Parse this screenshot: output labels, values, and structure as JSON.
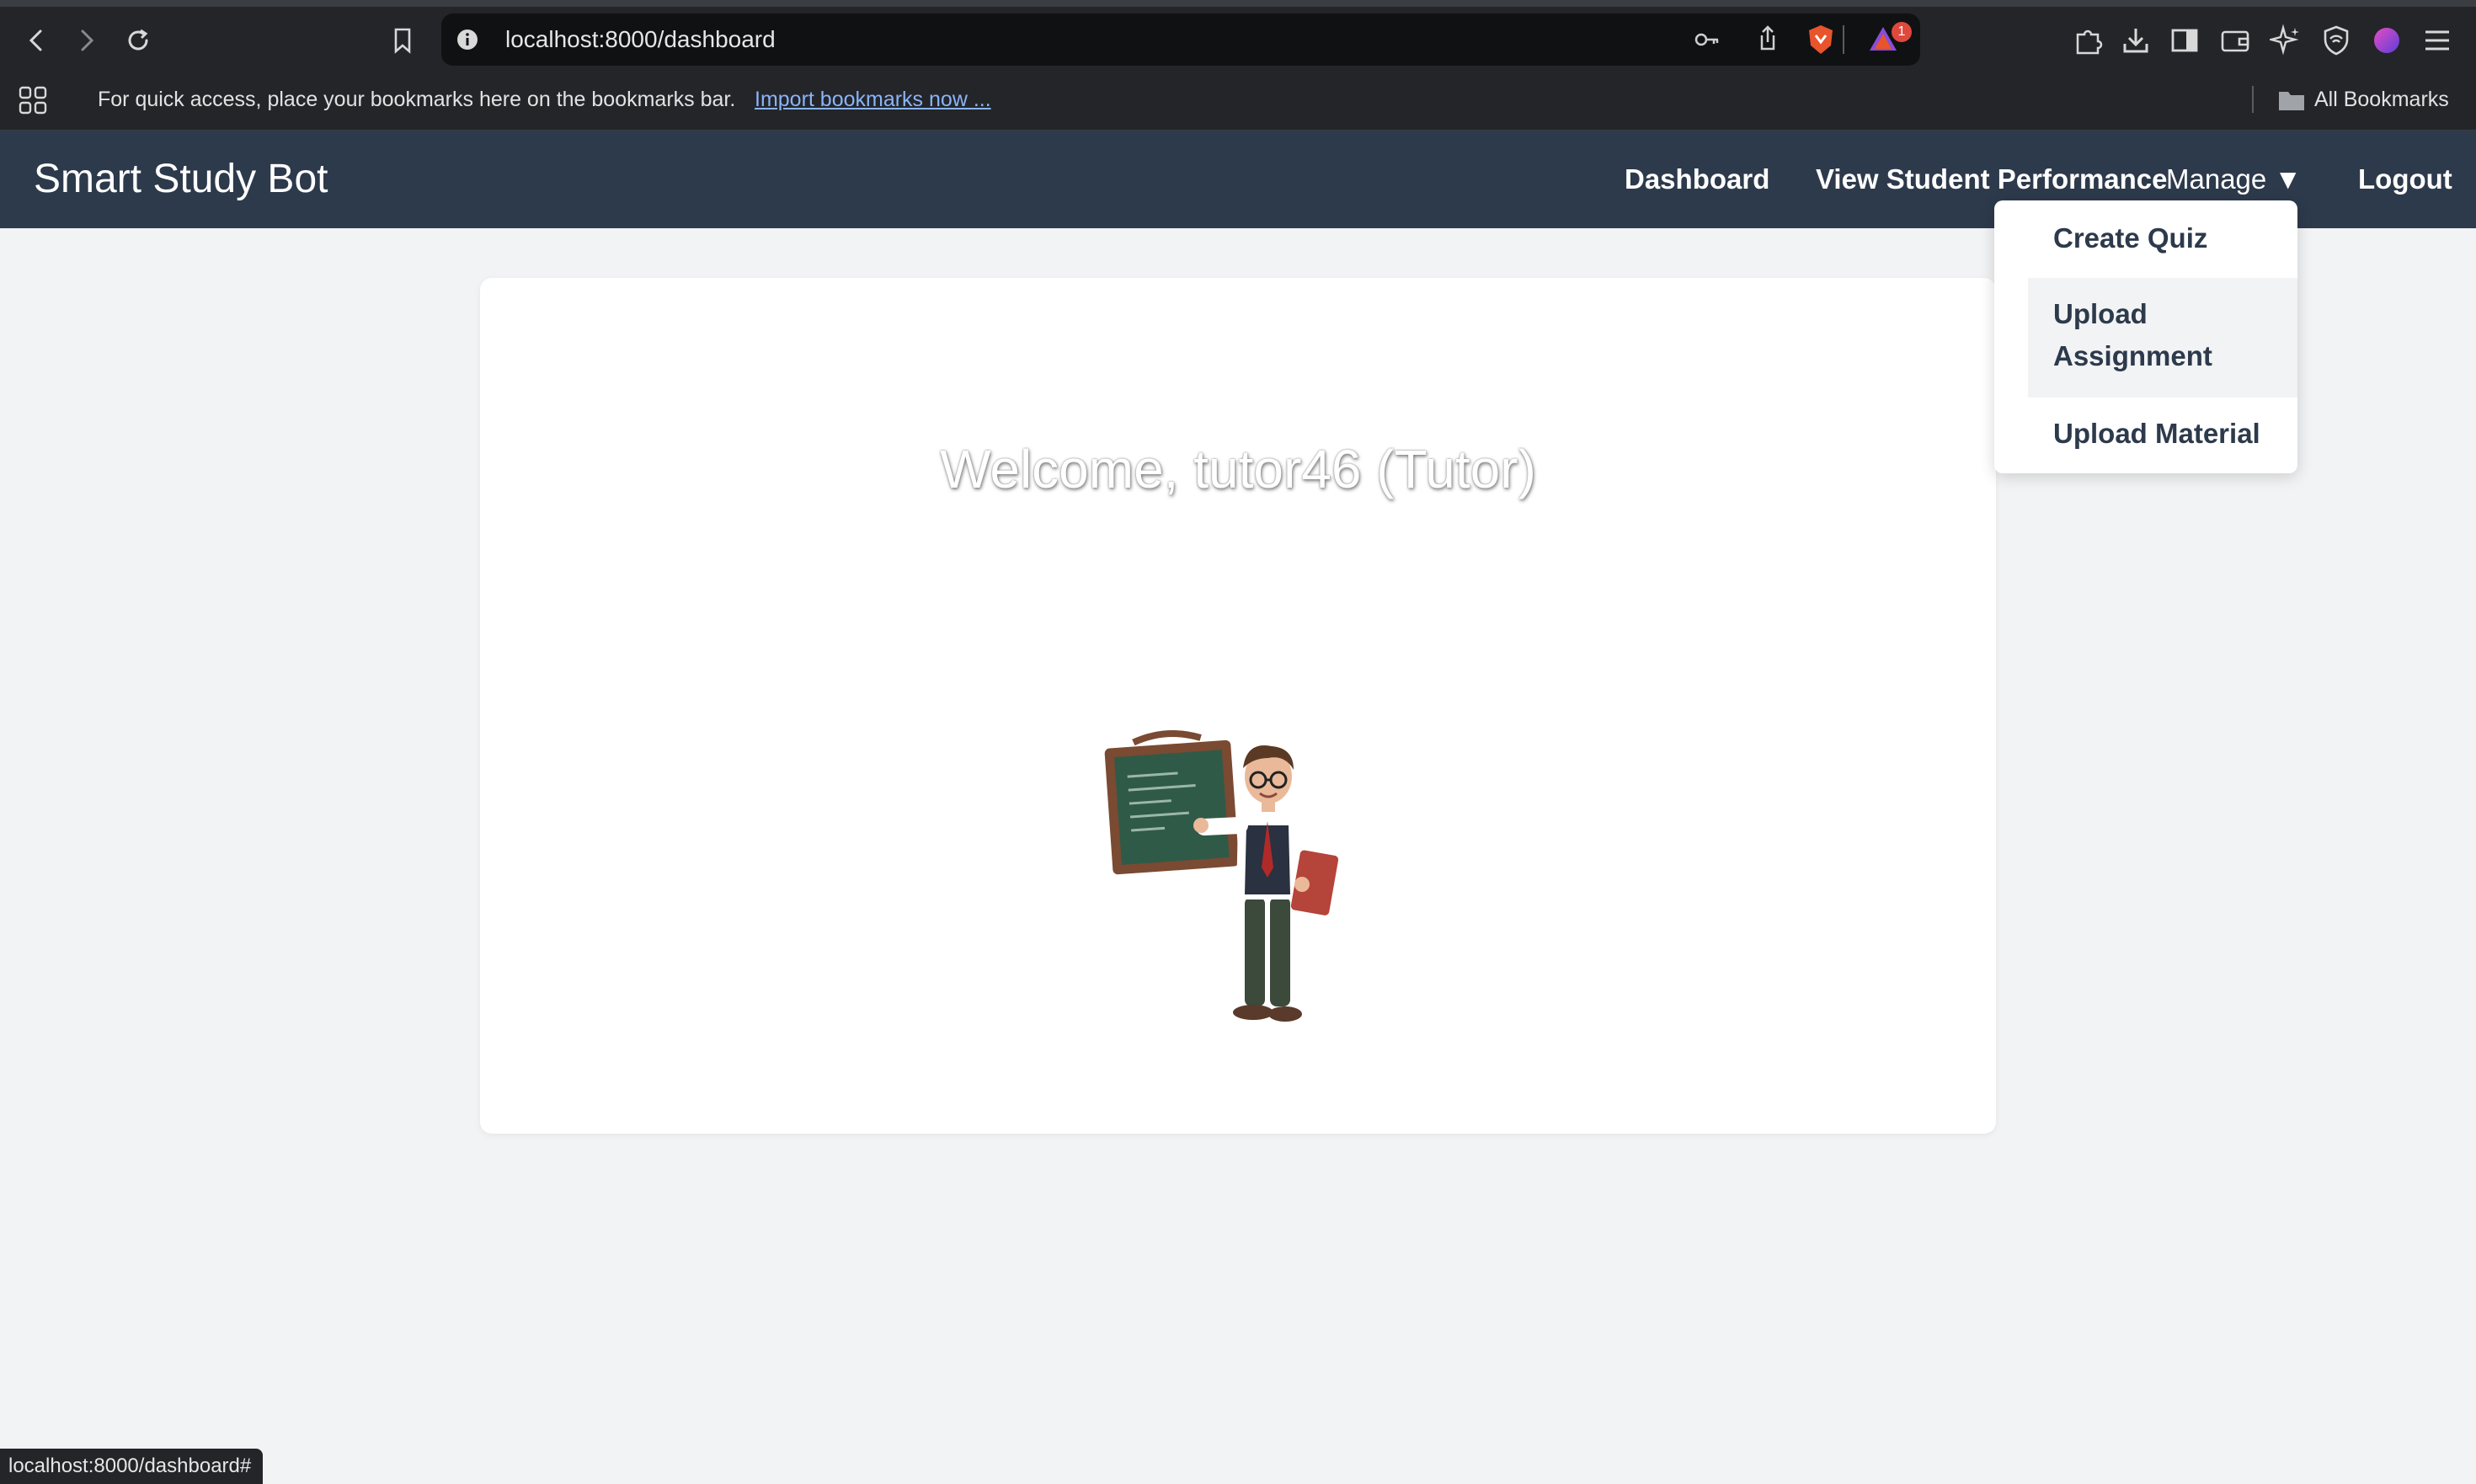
{
  "browser": {
    "url": "localhost:8000/dashboard",
    "notification_count": "1",
    "bookmarks_bar": {
      "message": "For quick access, place your bookmarks here on the bookmarks bar.",
      "import_link": "Import bookmarks now ...",
      "all_bookmarks": "All Bookmarks"
    },
    "status_url": "localhost:8000/dashboard#"
  },
  "navbar": {
    "brand": "Smart Study Bot",
    "links": {
      "dashboard": "Dashboard",
      "performance": "View Student Performance",
      "manage": "Manage ▼",
      "logout": "Logout"
    }
  },
  "manage_menu": {
    "items": [
      "Create Quiz",
      "Upload",
      "Assignment",
      "Upload Material"
    ]
  },
  "main": {
    "welcome": "Welcome, tutor46 (Tutor)"
  },
  "colors": {
    "navbar_bg": "#2d3a4b",
    "page_bg": "#f2f3f5",
    "chrome_bg": "#232529"
  }
}
